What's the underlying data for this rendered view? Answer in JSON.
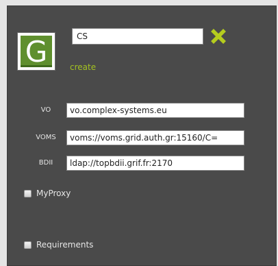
{
  "header": {
    "logo_letter": "G",
    "name_value": "CS",
    "close_icon": "close-x-icon",
    "create_label": "create"
  },
  "fields": [
    {
      "label": "VO",
      "value": "vo.complex-systems.eu"
    },
    {
      "label": "VOMS",
      "value": "voms://voms.grid.auth.gr:15160/C="
    },
    {
      "label": "BDII",
      "value": "ldap://topbdii.grif.fr:2170"
    }
  ],
  "options": [
    {
      "label": "MyProxy",
      "checked": false
    },
    {
      "label": "Requirements",
      "checked": false
    }
  ],
  "colors": {
    "panel_background": "#4a4a4a",
    "accent_green": "#a3c121",
    "logo_green": "#5f8f2e",
    "close_icon_color": "#b5cc1e"
  }
}
